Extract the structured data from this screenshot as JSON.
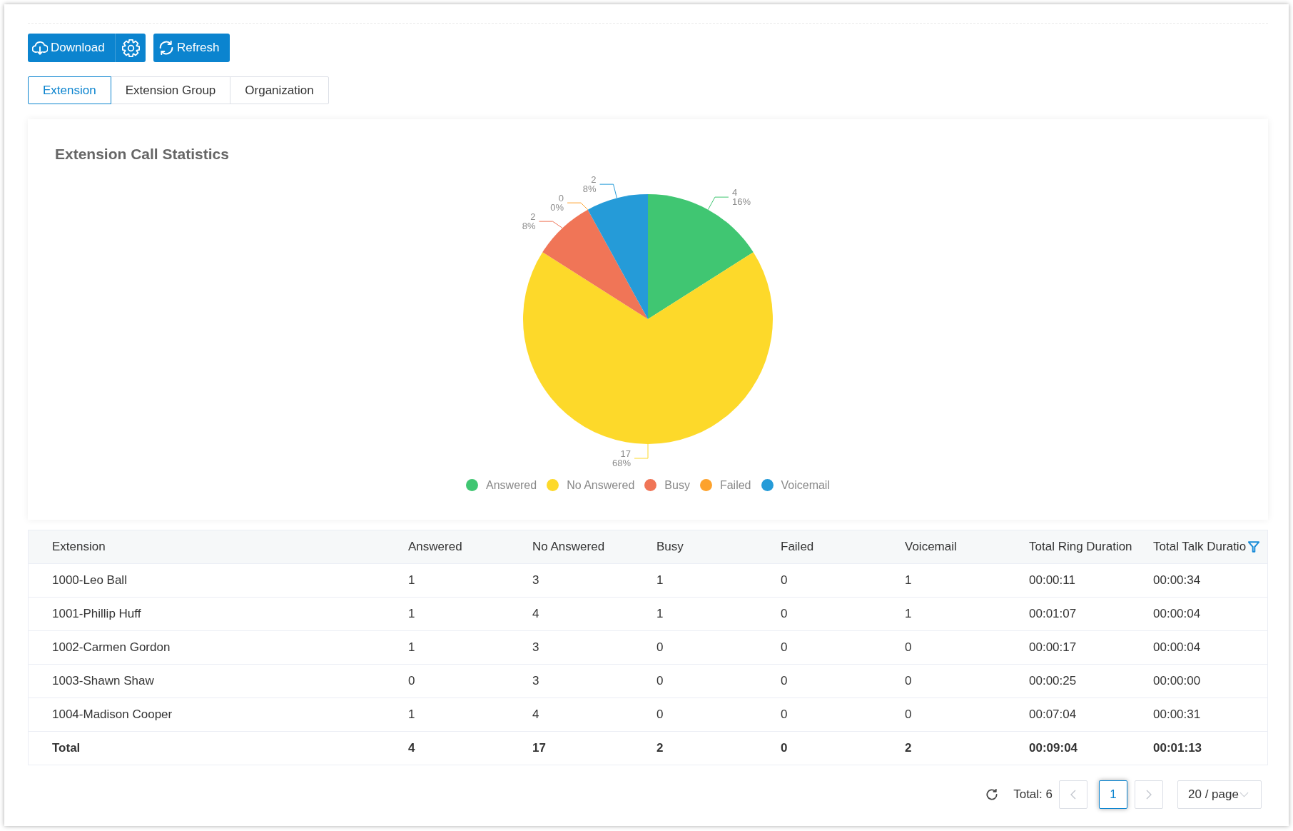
{
  "toolbar": {
    "download_button": {
      "label": "Download"
    },
    "refresh_button": {
      "label": "Refresh"
    }
  },
  "tabs": [
    {
      "label": "Extension",
      "selected": true
    },
    {
      "label": "Extension Group",
      "selected": false
    },
    {
      "label": "Organization",
      "selected": false
    }
  ],
  "chart_panel": {
    "chart_data": {
      "type": "pie",
      "title": "Extension Call Statistics",
      "categories": [
        "Answered",
        "No Answered",
        "Busy",
        "Failed",
        "Voicemail"
      ],
      "values": [
        16,
        68,
        8,
        0,
        8
      ],
      "colors": [
        "#40c672",
        "#fdd92a",
        "#f07557",
        "#fda22c",
        "#259bd8"
      ],
      "legend": "bottom",
      "value_labels": [
        {
          "value": "4",
          "percent": "16%"
        },
        {
          "value": "17",
          "percent": "68%"
        },
        {
          "value": "2",
          "percent": "8%"
        },
        {
          "value": "0",
          "percent": "0%"
        },
        {
          "value": "2",
          "percent": "8%"
        }
      ]
    }
  },
  "table": {
    "columns": [
      {
        "label": "Extension",
        "filter": false
      },
      {
        "label": "Answered",
        "filter": false
      },
      {
        "label": "No Answered",
        "filter": false
      },
      {
        "label": "Busy",
        "filter": false
      },
      {
        "label": "Failed",
        "filter": false
      },
      {
        "label": "Voicemail",
        "filter": false
      },
      {
        "label": "Total Ring Duration",
        "filter": false
      },
      {
        "label": "Total Talk Duratio",
        "filter": true
      }
    ],
    "rows": [
      {
        "kind": "data",
        "cells": [
          "1000-Leo Ball",
          "1",
          "3",
          "1",
          "0",
          "1",
          "00:00:11",
          "00:00:34"
        ]
      },
      {
        "kind": "data",
        "cells": [
          "1001-Phillip Huff",
          "1",
          "4",
          "1",
          "0",
          "1",
          "00:01:07",
          "00:00:04"
        ]
      },
      {
        "kind": "data",
        "cells": [
          "1002-Carmen Gordon",
          "1",
          "3",
          "0",
          "0",
          "0",
          "00:00:17",
          "00:00:04"
        ]
      },
      {
        "kind": "data",
        "cells": [
          "1003-Shawn Shaw",
          "0",
          "3",
          "0",
          "0",
          "0",
          "00:00:25",
          "00:00:00"
        ]
      },
      {
        "kind": "data",
        "cells": [
          "1004-Madison Cooper",
          "1",
          "4",
          "0",
          "0",
          "0",
          "00:07:04",
          "00:00:31"
        ]
      },
      {
        "kind": "total",
        "cells": [
          "Total",
          "4",
          "17",
          "2",
          "0",
          "2",
          "00:09:04",
          "00:01:13"
        ]
      }
    ]
  },
  "pagination": {
    "total": "Total: 6",
    "prev_disabled": true,
    "pages": [
      {
        "label": "1",
        "selected": true
      }
    ],
    "next_disabled": true,
    "page_size": "20 / page"
  }
}
